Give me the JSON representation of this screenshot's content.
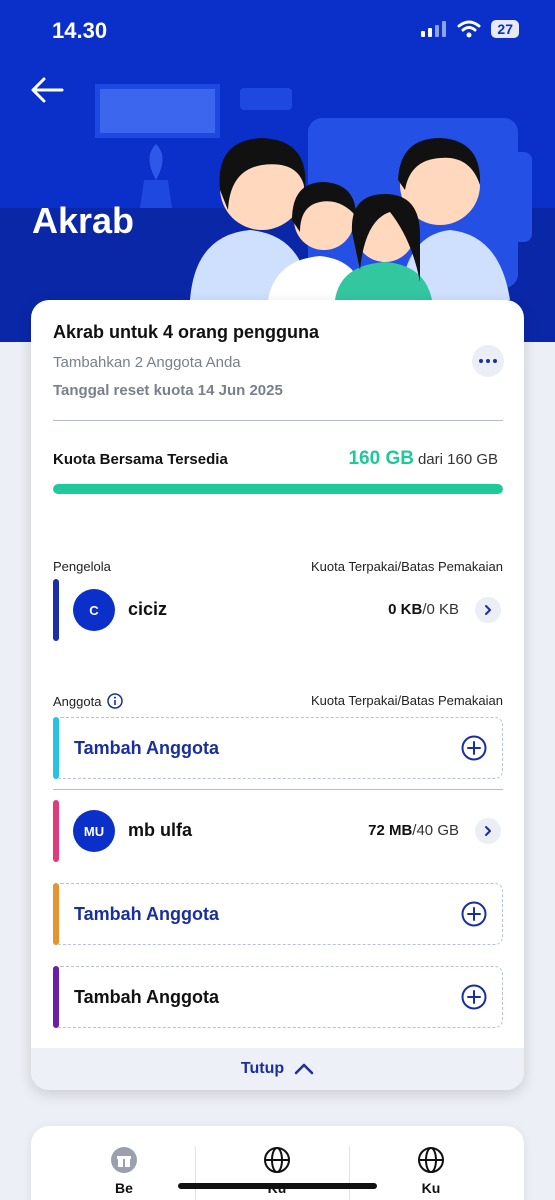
{
  "status_bar": {
    "time": "14.30",
    "battery": "27"
  },
  "header": {
    "title": "Akrab"
  },
  "plan": {
    "title": "Akrab untuk 4 orang pengguna",
    "subtitle": "Tambahkan 2 Anggota Anda",
    "reset_text": "Tanggal reset kuota 14 Jun 2025"
  },
  "quota": {
    "label": "Kuota Bersama Tersedia",
    "available": "160 GB",
    "total_text": "dari 160 GB",
    "fill_fraction": 1.0
  },
  "manager_section": {
    "label": "Pengelola",
    "right_label": "Kuota Terpakai/Batas Pemakaian",
    "manager": {
      "initials": "C",
      "name": "ciciz",
      "used": "0 KB",
      "limit": "/0 KB",
      "bar_color": "#1b2fa8"
    }
  },
  "members_section": {
    "label": "Anggota",
    "right_label": "Kuota Terpakai/Batas Pemakaian",
    "add_label_1": "Tambah Anggota",
    "member": {
      "initials": "MU",
      "name": "mb ulfa",
      "used": "72 MB",
      "limit": "/40 GB",
      "bar_color": "#e23a7a"
    },
    "add_label_2": "Tambah Anggota",
    "add_label_3": "Tambah Anggota"
  },
  "colors": {
    "header_blue": "#0b2fc9",
    "accent_green": "#1ec99a",
    "slot1_bar": "#27c3e6",
    "slot2_bar": "#e6952e",
    "slot3_bar": "#6b1fa6",
    "link_blue": "#1a2f9e"
  },
  "close": {
    "label": "Tutup"
  },
  "bottom_nav": [
    {
      "label": "Be",
      "icon": "gift-icon"
    },
    {
      "label": "Ku",
      "icon": "globe-icon"
    },
    {
      "label": "Ku",
      "icon": "globe-icon"
    }
  ]
}
